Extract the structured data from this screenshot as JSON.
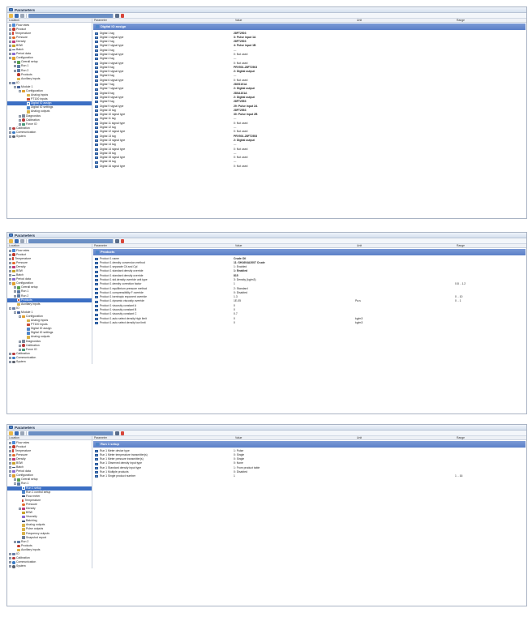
{
  "headers": {
    "location": "Location",
    "parameter": "Parameter",
    "value": "Value",
    "unit": "Unit",
    "range": "Range"
  },
  "windows": [
    {
      "title": "Parameters",
      "section": "Digital IO assign",
      "tree": [
        {
          "label": "Flow rates",
          "icon": "flow",
          "depth": 0,
          "exp": "+"
        },
        {
          "label": "Product",
          "icon": "product",
          "depth": 0,
          "exp": "+"
        },
        {
          "label": "Temperature",
          "icon": "temp",
          "depth": 0,
          "exp": "+"
        },
        {
          "label": "Pressure",
          "icon": "press",
          "depth": 0,
          "exp": "+"
        },
        {
          "label": "Density",
          "icon": "dens",
          "depth": 0,
          "exp": "+"
        },
        {
          "label": "BSW",
          "icon": "bsw",
          "depth": 0,
          "exp": "+"
        },
        {
          "label": "Batch",
          "icon": "batch",
          "depth": 0,
          "exp": "+"
        },
        {
          "label": "Period data",
          "icon": "period",
          "depth": 0,
          "exp": "+"
        },
        {
          "label": "Configuration",
          "icon": "config",
          "depth": 0,
          "exp": "-"
        },
        {
          "label": "Overall setup",
          "icon": "overall",
          "depth": 1,
          "exp": "+"
        },
        {
          "label": "Run 1",
          "icon": "run",
          "depth": 1,
          "exp": "+"
        },
        {
          "label": "Run 2",
          "icon": "run",
          "depth": 1,
          "exp": "+"
        },
        {
          "label": "Products",
          "icon": "product",
          "depth": 1,
          "exp": ""
        },
        {
          "label": "Auxiliary inputs",
          "icon": "aux",
          "depth": 1,
          "exp": ""
        },
        {
          "label": "IO",
          "icon": "io",
          "depth": 0,
          "exp": "-"
        },
        {
          "label": "Module 1",
          "icon": "module",
          "depth": 1,
          "exp": "-"
        },
        {
          "label": "Configuration",
          "icon": "config",
          "depth": 2,
          "exp": "-"
        },
        {
          "label": "Analog inputs",
          "icon": "analog",
          "depth": 3,
          "exp": ""
        },
        {
          "label": "PT100 inputs",
          "icon": "pt100",
          "depth": 3,
          "exp": ""
        },
        {
          "label": "Digital IO assign",
          "icon": "digital",
          "depth": 3,
          "exp": "",
          "selected": true
        },
        {
          "label": "Digital IO settings",
          "icon": "digital",
          "depth": 3,
          "exp": ""
        },
        {
          "label": "Analog outputs",
          "icon": "analog",
          "depth": 3,
          "exp": ""
        },
        {
          "label": "Diagnostics",
          "icon": "diag",
          "depth": 2,
          "exp": "+"
        },
        {
          "label": "Calibration",
          "icon": "calib",
          "depth": 2,
          "exp": "+"
        },
        {
          "label": "Force IO",
          "icon": "force",
          "depth": 2,
          "exp": "+"
        },
        {
          "label": "Calibration",
          "icon": "calib",
          "depth": 0,
          "exp": "+"
        },
        {
          "label": "Communication",
          "icon": "comm",
          "depth": 0,
          "exp": "+"
        },
        {
          "label": "System",
          "icon": "system",
          "depth": 0,
          "exp": "+"
        }
      ],
      "rows": [
        {
          "p": "Digital 1 tag",
          "v": "28FT2503",
          "b": true
        },
        {
          "p": "Digital 1 signal type",
          "v": "3: Pulse input 1A",
          "b": true
        },
        {
          "p": "Digital 2 tag",
          "v": "28FT2503",
          "b": true
        },
        {
          "p": "Digital 2 signal type",
          "v": "4: Pulse input 1B",
          "b": true
        },
        {
          "p": "Digital 3 tag",
          "v": "---"
        },
        {
          "p": "Digital 3 signal type",
          "v": "0: Not used"
        },
        {
          "p": "Digital 4 tag",
          "v": "---"
        },
        {
          "p": "Digital 4 signal type",
          "v": "0: Not used"
        },
        {
          "p": "Digital 5 tag",
          "v": "PRV501-28FT2503",
          "b": true
        },
        {
          "p": "Digital 5 signal type",
          "v": "2: Digital output",
          "b": true
        },
        {
          "p": "Digital 6 tag",
          "v": "---"
        },
        {
          "p": "Digital 6 signal type",
          "v": "0: Not used"
        },
        {
          "p": "Digital 7 tag",
          "v": "28XS101A",
          "b": true
        },
        {
          "p": "Digital 7 signal type",
          "v": "2: Digital output",
          "b": true
        },
        {
          "p": "Digital 8 tag",
          "v": "28XA101A",
          "b": true
        },
        {
          "p": "Digital 8 signal type",
          "v": "2: Digital output",
          "b": true
        },
        {
          "p": "Digital 9 tag",
          "v": "28FT2553",
          "b": true
        },
        {
          "p": "Digital 9 signal type",
          "v": "29: Pulse input 2A",
          "b": true
        },
        {
          "p": "Digital 10 tag",
          "v": "28FT2553",
          "b": true
        },
        {
          "p": "Digital 10 signal type",
          "v": "30: Pulse input 2B",
          "b": true
        },
        {
          "p": "Digital 11 tag",
          "v": "---"
        },
        {
          "p": "Digital 11 signal type",
          "v": "0: Not used"
        },
        {
          "p": "Digital 12 tag",
          "v": "---"
        },
        {
          "p": "Digital 12 signal type",
          "v": "0: Not used"
        },
        {
          "p": "Digital 13 tag",
          "v": "PRV501-28FT2553",
          "b": true
        },
        {
          "p": "Digital 13 signal type",
          "v": "2: Digital output",
          "b": true
        },
        {
          "p": "Digital 14 tag",
          "v": "---"
        },
        {
          "p": "Digital 14 signal type",
          "v": "0: Not used"
        },
        {
          "p": "Digital 15 tag",
          "v": "---"
        },
        {
          "p": "Digital 15 signal type",
          "v": "0: Not used"
        },
        {
          "p": "Digital 16 tag",
          "v": "---"
        },
        {
          "p": "Digital 16 signal type",
          "v": "0: Not used"
        }
      ]
    },
    {
      "title": "Parameters",
      "section": "Products",
      "tree": [
        {
          "label": "Flow rates",
          "icon": "flow",
          "depth": 0,
          "exp": "+"
        },
        {
          "label": "Product",
          "icon": "product",
          "depth": 0,
          "exp": "+"
        },
        {
          "label": "Temperature",
          "icon": "temp",
          "depth": 0,
          "exp": "+"
        },
        {
          "label": "Pressure",
          "icon": "press",
          "depth": 0,
          "exp": "+"
        },
        {
          "label": "Density",
          "icon": "dens",
          "depth": 0,
          "exp": "+"
        },
        {
          "label": "BSW",
          "icon": "bsw",
          "depth": 0,
          "exp": "+"
        },
        {
          "label": "Batch",
          "icon": "batch",
          "depth": 0,
          "exp": "+"
        },
        {
          "label": "Period data",
          "icon": "period",
          "depth": 0,
          "exp": "+"
        },
        {
          "label": "Configuration",
          "icon": "config",
          "depth": 0,
          "exp": "-"
        },
        {
          "label": "Overall setup",
          "icon": "overall",
          "depth": 1,
          "exp": "+"
        },
        {
          "label": "Run 1",
          "icon": "run",
          "depth": 1,
          "exp": "+"
        },
        {
          "label": "Run 2",
          "icon": "run",
          "depth": 1,
          "exp": "+"
        },
        {
          "label": "Products",
          "icon": "product",
          "depth": 1,
          "exp": "",
          "selected": true
        },
        {
          "label": "Auxiliary inputs",
          "icon": "aux",
          "depth": 1,
          "exp": ""
        },
        {
          "label": "IO",
          "icon": "io",
          "depth": 0,
          "exp": "-"
        },
        {
          "label": "Module 1",
          "icon": "module",
          "depth": 1,
          "exp": "-"
        },
        {
          "label": "Configuration",
          "icon": "config",
          "depth": 2,
          "exp": "-"
        },
        {
          "label": "Analog inputs",
          "icon": "analog",
          "depth": 3,
          "exp": ""
        },
        {
          "label": "PT100 inputs",
          "icon": "pt100",
          "depth": 3,
          "exp": ""
        },
        {
          "label": "Digital IO assign",
          "icon": "digital",
          "depth": 3,
          "exp": ""
        },
        {
          "label": "Digital IO settings",
          "icon": "digital",
          "depth": 3,
          "exp": ""
        },
        {
          "label": "Analog outputs",
          "icon": "analog",
          "depth": 3,
          "exp": ""
        },
        {
          "label": "Diagnostics",
          "icon": "diag",
          "depth": 2,
          "exp": "+"
        },
        {
          "label": "Calibration",
          "icon": "calib",
          "depth": 2,
          "exp": "+"
        },
        {
          "label": "Force IO",
          "icon": "force",
          "depth": 2,
          "exp": "+"
        },
        {
          "label": "Calibration",
          "icon": "calib",
          "depth": 0,
          "exp": "+"
        },
        {
          "label": "Communication",
          "icon": "comm",
          "depth": 0,
          "exp": "+"
        },
        {
          "label": "System",
          "icon": "system",
          "depth": 0,
          "exp": "+"
        }
      ],
      "rows": [
        {
          "p": "Product 1 name",
          "v": "Crude Oil",
          "b": true
        },
        {
          "p": "Product 1 density conversion method",
          "v": "11: SH1604A2007 Crude",
          "b": true
        },
        {
          "p": "Product 1 separate Ctl and Cpl",
          "v": "1: Enabled"
        },
        {
          "p": "Product 1 standard density override",
          "v": "1: Enabled",
          "b": true
        },
        {
          "p": "Product 1 standard density override",
          "v": "815",
          "b": true
        },
        {
          "p": "Product 1 std.density override unit type",
          "v": "3: Density (kg/m3)"
        },
        {
          "p": "Product 1 density correction factor",
          "v": "1",
          "r": "0.8 .. 1.2"
        },
        {
          "p": "Product 1 equilibrium pressure method",
          "v": "2: Standard"
        },
        {
          "p": "Product 1 compressibility F override",
          "v": "0: Disabled"
        },
        {
          "p": "Product 1 isentropic exponent override",
          "v": "1.3",
          "r": "0 .. 10"
        },
        {
          "p": "Product 1 dynamic viscosity override",
          "v": "1E-05",
          "u": "Pa.s",
          "r": "0 .. 1"
        },
        {
          "p": "Product 1 viscosity constant A",
          "v": "0"
        },
        {
          "p": "Product 1 viscosity constant B",
          "v": "0"
        },
        {
          "p": "Product 1 viscosity constant C",
          "v": "0.7"
        },
        {
          "p": "Product 1 auto select density high limit",
          "v": "0",
          "u": "kg/m3"
        },
        {
          "p": "Product 1 auto select density low limit",
          "v": "0",
          "u": "kg/m3"
        }
      ]
    },
    {
      "title": "Parameters",
      "section": "Run 1 setup",
      "tree": [
        {
          "label": "Flow rates",
          "icon": "flow",
          "depth": 0,
          "exp": "+"
        },
        {
          "label": "Product",
          "icon": "product",
          "depth": 0,
          "exp": "+"
        },
        {
          "label": "Temperature",
          "icon": "temp",
          "depth": 0,
          "exp": "+"
        },
        {
          "label": "Pressure",
          "icon": "press",
          "depth": 0,
          "exp": "+"
        },
        {
          "label": "Density",
          "icon": "dens",
          "depth": 0,
          "exp": "+"
        },
        {
          "label": "BSW",
          "icon": "bsw",
          "depth": 0,
          "exp": "+"
        },
        {
          "label": "Batch",
          "icon": "batch",
          "depth": 0,
          "exp": "+"
        },
        {
          "label": "Period data",
          "icon": "period",
          "depth": 0,
          "exp": "+"
        },
        {
          "label": "Configuration",
          "icon": "config",
          "depth": 0,
          "exp": "-"
        },
        {
          "label": "Overall setup",
          "icon": "overall",
          "depth": 1,
          "exp": "+"
        },
        {
          "label": "Run 1",
          "icon": "run",
          "depth": 1,
          "exp": "-"
        },
        {
          "label": "Run 1 setup",
          "icon": "setup",
          "depth": 2,
          "exp": "",
          "selected": true
        },
        {
          "label": "Run 1 control setup",
          "icon": "setup",
          "depth": 2,
          "exp": ""
        },
        {
          "label": "Flow meter",
          "icon": "flowm",
          "depth": 2,
          "exp": ""
        },
        {
          "label": "Temperature",
          "icon": "temp",
          "depth": 2,
          "exp": ""
        },
        {
          "label": "Pressure",
          "icon": "press",
          "depth": 2,
          "exp": ""
        },
        {
          "label": "Density",
          "icon": "dens",
          "depth": 2,
          "exp": "+"
        },
        {
          "label": "BSW",
          "icon": "bsw",
          "depth": 2,
          "exp": ""
        },
        {
          "label": "Viscosity",
          "icon": "period",
          "depth": 2,
          "exp": ""
        },
        {
          "label": "Batching",
          "icon": "batch",
          "depth": 2,
          "exp": ""
        },
        {
          "label": "Analog outputs",
          "icon": "analog",
          "depth": 2,
          "exp": ""
        },
        {
          "label": "Pulse outputs",
          "icon": "analog",
          "depth": 2,
          "exp": ""
        },
        {
          "label": "Frequency outputs",
          "icon": "analog",
          "depth": 2,
          "exp": ""
        },
        {
          "label": "Snapshot report",
          "icon": "report",
          "depth": 2,
          "exp": ""
        },
        {
          "label": "Run 2",
          "icon": "run",
          "depth": 1,
          "exp": "+"
        },
        {
          "label": "Products",
          "icon": "product",
          "depth": 1,
          "exp": ""
        },
        {
          "label": "Auxiliary inputs",
          "icon": "aux",
          "depth": 1,
          "exp": ""
        },
        {
          "label": "IO",
          "icon": "io",
          "depth": 0,
          "exp": "+"
        },
        {
          "label": "Calibration",
          "icon": "calib",
          "depth": 0,
          "exp": "+"
        },
        {
          "label": "Communication",
          "icon": "comm",
          "depth": 0,
          "exp": "+"
        },
        {
          "label": "System",
          "icon": "system",
          "depth": 0,
          "exp": "+"
        }
      ],
      "rows": [
        {
          "p": "Run 1 Meter device type",
          "v": "1: Pulse"
        },
        {
          "p": "Run 1 Meter temperature transmitter(s)",
          "v": "0: Single"
        },
        {
          "p": "Run 1 Meter pressure transmitter(s)",
          "v": "0: Single"
        },
        {
          "p": "Run 1 Observed density input type",
          "v": "0: None"
        },
        {
          "p": "Run 1 Standard density input type",
          "v": "1: From product table"
        },
        {
          "p": "Run 1 Multiple products",
          "v": "0: Disabled"
        },
        {
          "p": "Run 1 Single product number",
          "v": "1",
          "r": "1 .. 16"
        }
      ]
    }
  ]
}
